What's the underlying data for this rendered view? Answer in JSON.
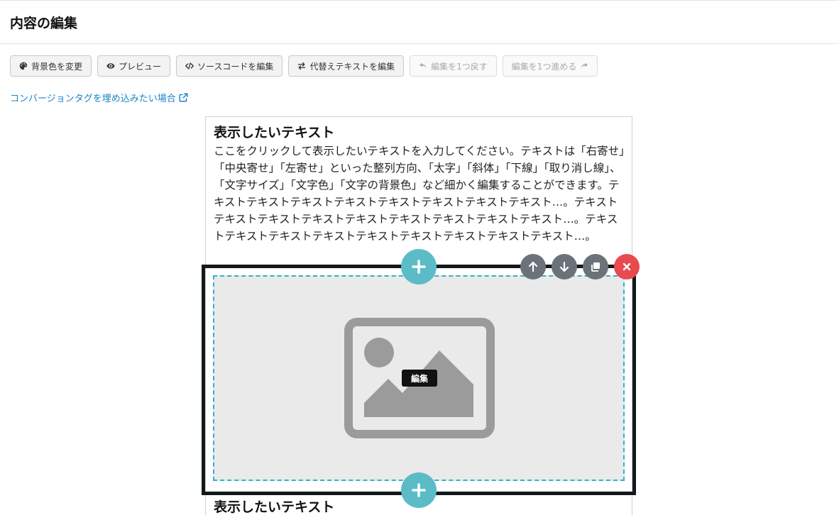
{
  "header": {
    "title": "内容の編集"
  },
  "toolbar": {
    "bg_color_label": "背景色を変更",
    "preview_label": "プレビュー",
    "source_label": "ソースコードを編集",
    "alt_text_label": "代替えテキストを編集",
    "undo_label": "編集を1つ戻す",
    "redo_label": "編集を1つ進める"
  },
  "conversion_link": {
    "label": "コンバージョンタグを埋め込みたい場合"
  },
  "text_block": {
    "heading": "表示したいテキスト",
    "body": "ここをクリックして表示したいテキストを入力してください。テキストは「右寄せ」「中央寄せ」「左寄せ」といった整列方向、「太字」「斜体」「下線」「取り消し線」、「文字サイズ」「文字色」「文字の背景色」など細かく編集することができます。テキストテキストテキストテキストテキストテキストテキストテキスト…。テキストテキストテキストテキストテキストテキストテキストテキストテキスト…。テキストテキストテキストテキストテキストテキストテキストテキストテキスト…。"
  },
  "image_block": {
    "edit_label": "編集"
  },
  "text_block_2": {
    "heading": "表示したいテキスト"
  },
  "colors": {
    "accent": "#1a84c7",
    "add_button": "#5bbcc8",
    "control_button": "#6b727a",
    "delete_button": "#e84a4f",
    "selection_border": "#13181b",
    "dashed_outline": "#2cb3cc"
  },
  "icons": {
    "bg_color": "palette-icon",
    "preview": "eye-icon",
    "source": "code-icon",
    "alt_text": "swap-icon",
    "undo": "undo-icon",
    "redo": "redo-icon",
    "external_link": "external-link-icon",
    "add": "plus-icon",
    "move_up": "arrow-up-icon",
    "move_down": "arrow-down-icon",
    "duplicate": "copy-icon",
    "delete": "close-icon",
    "image_placeholder": "image-placeholder-icon"
  }
}
